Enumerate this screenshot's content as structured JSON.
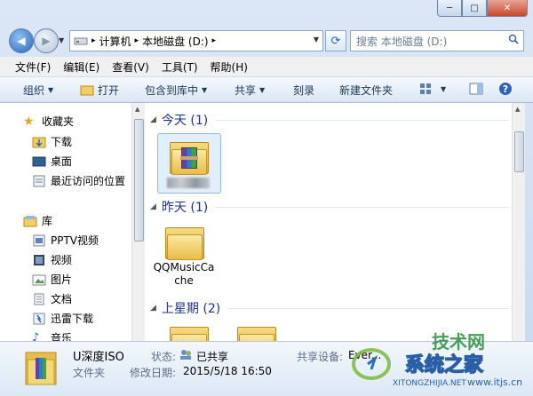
{
  "window": {
    "controls": {
      "minimize": "─",
      "maximize": "□",
      "close": "✕"
    }
  },
  "address_bar": {
    "path": [
      "计算机",
      "本地磁盘 (D:)"
    ],
    "separator": "▸",
    "search_placeholder": "搜索 本地磁盘 (D:)"
  },
  "menu": [
    "文件(F)",
    "编辑(E)",
    "查看(V)",
    "工具(T)",
    "帮助(H)"
  ],
  "commands": {
    "organize": "组织",
    "open": "打开",
    "include_library": "包含到库中",
    "share": "共享",
    "burn": "刻录",
    "new_folder": "新建文件夹"
  },
  "sidebar": {
    "favorites_title": "收藏夹",
    "favorites": [
      "下载",
      "桌面",
      "最近访问的位置"
    ],
    "libraries_title": "库",
    "libraries": [
      "PPTV视频",
      "视频",
      "图片",
      "文档",
      "迅雷下载",
      "音乐"
    ]
  },
  "groups": [
    {
      "title": "今天 (1)"
    },
    {
      "title": "昨天 (1)",
      "file": "QQMusicCache"
    },
    {
      "title": "上星期 (2)"
    }
  ],
  "details": {
    "name": "U深度ISO",
    "type": "文件夹",
    "status_label": "状态:",
    "status_value": "已共享",
    "modified_label": "修改日期:",
    "modified_value": "2015/5/18 16:50",
    "shared_with_label": "共享设备:",
    "shared_with_value": "Ever..."
  },
  "watermark": {
    "brand": "系统之家",
    "site": "技术网",
    "url": "XITONGZHIJIA.NET",
    "url2": "www.itjs.cn"
  },
  "colors": {
    "accent": "#1e3287",
    "selection": "#e3eefb"
  }
}
